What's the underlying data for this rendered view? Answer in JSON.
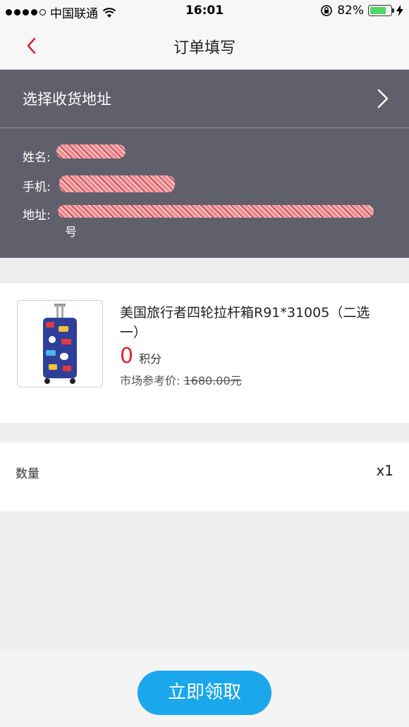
{
  "status_bar": {
    "carrier": "中国联通",
    "time": "16:01",
    "battery_percent": "82%",
    "battery_level": 0.82,
    "icons": [
      "signal-dots-icon",
      "wifi-icon",
      "rotation-lock-icon",
      "battery-icon",
      "charging-bolt-icon"
    ]
  },
  "nav": {
    "title": "订单填写",
    "back_icon": "chevron-left-icon"
  },
  "address": {
    "select_label": "选择收货地址",
    "chevron_icon": "chevron-right-icon",
    "name_label": "姓名:",
    "phone_label": "手机:",
    "addr_label": "地址:",
    "addr_tail": "号"
  },
  "product": {
    "title": "美国旅行者四轮拉杆箱R91*31005（二选一）",
    "points": "0",
    "points_unit": "积分",
    "market_label": "市场参考价:",
    "market_price": "1680.00元",
    "image_icon": "suitcase-image"
  },
  "quantity": {
    "label": "数量",
    "value": "x1"
  },
  "action": {
    "claim_label": "立即领取"
  },
  "colors": {
    "accent": "#1aa7ec",
    "price_red": "#e0242e",
    "address_bg": "#5f606b",
    "back_red": "#e0242e"
  }
}
